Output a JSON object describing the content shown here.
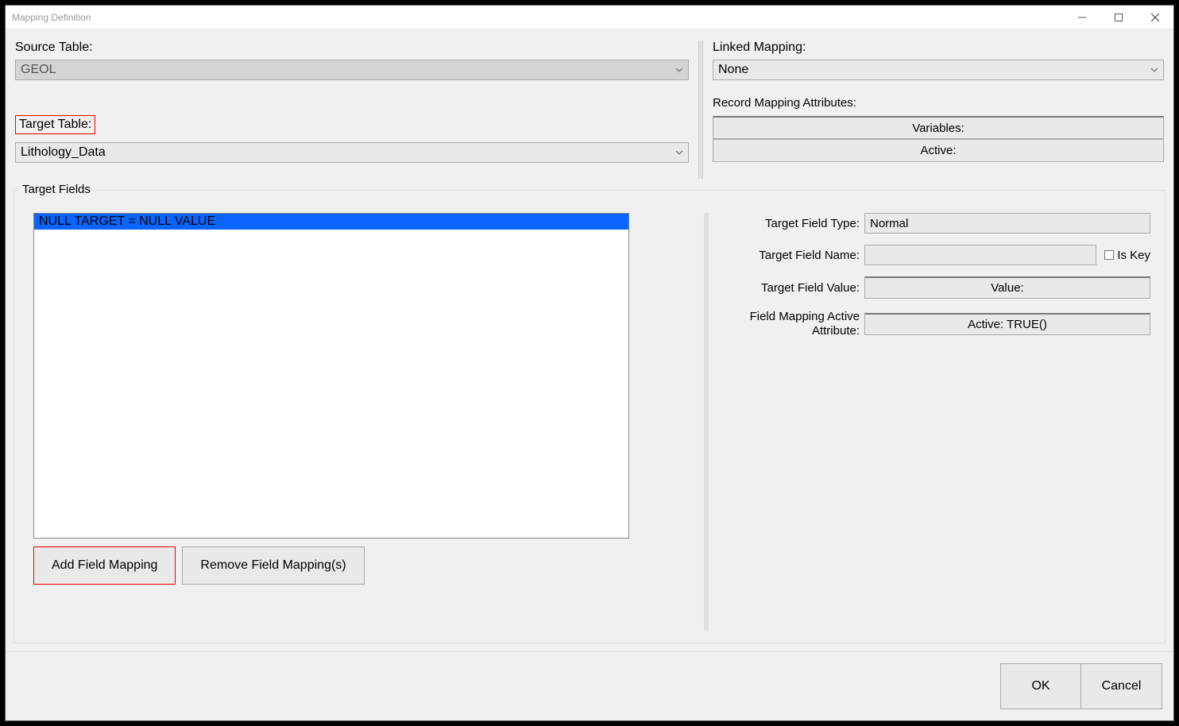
{
  "window": {
    "title": "Mapping Definition"
  },
  "upper": {
    "sourceTable": {
      "label": "Source Table:",
      "value": "GEOL"
    },
    "targetTable": {
      "label": "Target Table:",
      "value": "Lithology_Data"
    },
    "linkedMapping": {
      "label": "Linked Mapping:",
      "value": "None"
    },
    "recordAttributes": {
      "label": "Record Mapping Attributes:",
      "variablesBtn": "Variables:",
      "activeBtn": "Active:"
    }
  },
  "targetFields": {
    "legend": "Target Fields",
    "listItems": [
      "NULL TARGET = NULL VALUE"
    ],
    "addBtn": "Add Field Mapping",
    "removeBtn": "Remove Field Mapping(s)",
    "props": {
      "typeLabel": "Target Field Type:",
      "typeValue": "Normal",
      "nameLabel": "Target Field Name:",
      "nameValue": "",
      "isKeyLabel": "Is Key",
      "valueLabel": "Target Field Value:",
      "valueBtn": "Value:",
      "activeLabel1": "Field Mapping Active",
      "activeLabel2": "Attribute:",
      "activeBtn": "Active: TRUE()"
    }
  },
  "footer": {
    "ok": "OK",
    "cancel": "Cancel"
  }
}
